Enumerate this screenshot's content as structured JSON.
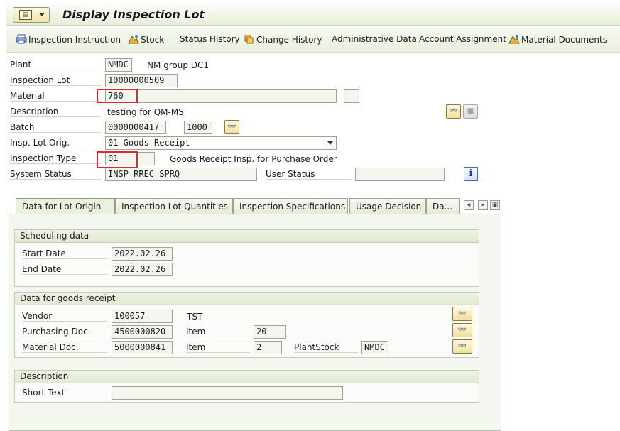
{
  "title": "Display Inspection Lot",
  "toolbar": {
    "items": [
      "Inspection Instruction",
      "Stock",
      "Status History",
      "Change History",
      "Administrative Data",
      "Account Assignment",
      "Material Documents"
    ]
  },
  "header": {
    "plant_label": "Plant",
    "plant_value": "NMDC",
    "plant_desc": "NM group DC1",
    "lot_label": "Inspection Lot",
    "lot_value": "10000000509",
    "material_label": "Material",
    "material_value": "760",
    "desc_label": "Description",
    "desc_value": "testing for QM-MS",
    "batch_label": "Batch",
    "batch_value": "0000000417",
    "batch_extra": "1000",
    "orig_label": "Insp. Lot Orig.",
    "orig_value": "01 Goods Receipt",
    "type_label": "Inspection Type",
    "type_value": "01",
    "type_desc": "Goods Receipt Insp. for Purchase Order",
    "sys_status_label": "System Status",
    "sys_status_value": "INSP RREC SPRQ",
    "user_status_label": "User Status",
    "user_status_value": ""
  },
  "tabs": [
    "Data for Lot Origin",
    "Inspection Lot Quantities",
    "Inspection Specifications",
    "Usage Decision",
    "Da..."
  ],
  "scheduling": {
    "title": "Scheduling data",
    "start_label": "Start Date",
    "start_value": "2022.02.26",
    "end_label": "End Date",
    "end_value": "2022.02.26"
  },
  "goods_receipt": {
    "title": "Data for goods receipt",
    "vendor_label": "Vendor",
    "vendor_value": "100057",
    "vendor_name": "TST",
    "po_label": "Purchasing Doc.",
    "po_value": "4500000820",
    "po_item_label": "Item",
    "po_item_value": "20",
    "matdoc_label": "Material Doc.",
    "matdoc_value": "5000000841",
    "matdoc_item_label": "Item",
    "matdoc_item_value": "2",
    "plantstock_label": "PlantStock",
    "plantstock_value": "NMDC"
  },
  "description_group": {
    "title": "Description",
    "short_text_label": "Short Text",
    "short_text_value": ""
  }
}
